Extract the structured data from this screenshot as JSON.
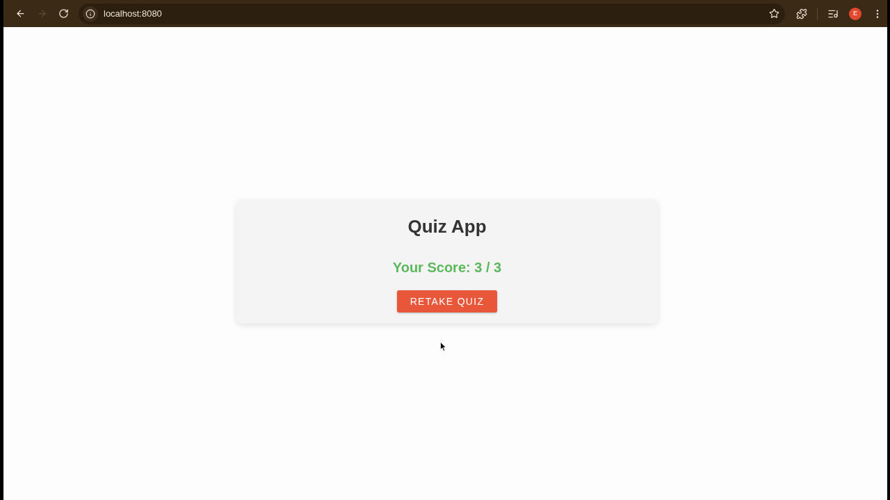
{
  "browser": {
    "nav_buttons": [
      {
        "kind": "back",
        "disabled": false
      },
      {
        "kind": "forward",
        "disabled": true
      },
      {
        "kind": "reload",
        "disabled": false
      }
    ],
    "url": "localhost:8080",
    "profile_initial": "E"
  },
  "card": {
    "title": "Quiz App",
    "score": "Your Score: 3 / 3",
    "button": "RETAKE QUIZ"
  }
}
